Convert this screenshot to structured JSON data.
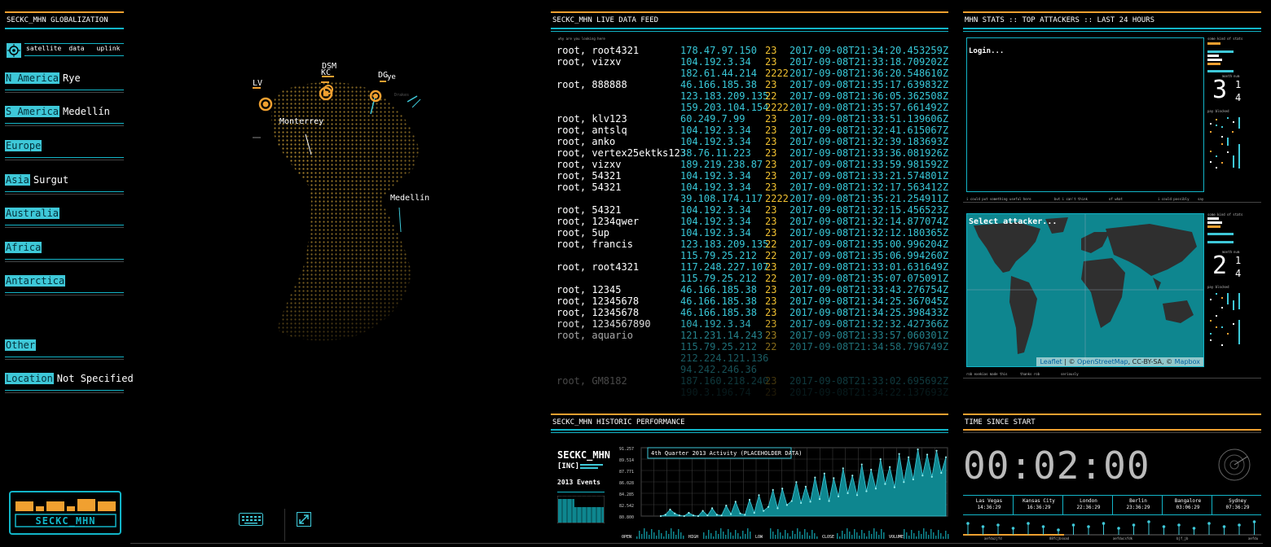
{
  "left": {
    "title": "SECKC_MHN GLOBALIZATION",
    "menu": [
      "satellite",
      "data",
      "uplink"
    ],
    "regions": [
      {
        "label": "N America",
        "value": "Rye"
      },
      {
        "label": "S America",
        "value": "Medellín"
      },
      {
        "label": "Europe",
        "value": ""
      },
      {
        "label": "Asia",
        "value": "Surgut"
      },
      {
        "label": "Australia",
        "value": ""
      },
      {
        "label": "Africa",
        "value": ""
      },
      {
        "label": "Antarctica",
        "value": ""
      },
      {
        "label": "Other",
        "value": ""
      },
      {
        "label": "Location",
        "value": "Not Specified"
      }
    ],
    "logo": "SECKC_MHN"
  },
  "globe": {
    "labels": {
      "lv": "LV",
      "dsm": "DSM",
      "kc": "KC",
      "dg": "DG",
      "rye": "ye",
      "monterrey": "Monterrey",
      "medellin": "Medellín",
      "faint": "Drakes"
    }
  },
  "feed": {
    "title": "SECKC_MHN LIVE DATA FEED",
    "subtitle": "why are you looking here",
    "rows": [
      {
        "user": "root, root4321",
        "ip": "178.47.97.150",
        "port": "23",
        "time": "2017-09-08T21:34:20.453259Z"
      },
      {
        "user": "root, vizxv",
        "ip": "104.192.3.34",
        "port": "23",
        "time": "2017-09-08T21:33:18.709202Z"
      },
      {
        "user": "",
        "ip": "182.61.44.214",
        "port": "2222",
        "time": "2017-09-08T21:36:20.548610Z"
      },
      {
        "user": "root, 888888",
        "ip": "46.166.185.38",
        "port": "23",
        "time": "2017-09-08T21:35:17.639832Z"
      },
      {
        "user": "",
        "ip": "123.183.209.135",
        "port": "22",
        "time": "2017-09-08T21:36:05.362508Z"
      },
      {
        "user": "",
        "ip": "159.203.104.154",
        "port": "2222",
        "time": "2017-09-08T21:35:57.661492Z"
      },
      {
        "user": "root, klv123",
        "ip": "60.249.7.99",
        "port": "23",
        "time": "2017-09-08T21:33:51.139606Z"
      },
      {
        "user": "root, antslq",
        "ip": "104.192.3.34",
        "port": "23",
        "time": "2017-09-08T21:32:41.615067Z"
      },
      {
        "user": "root, anko",
        "ip": "104.192.3.34",
        "port": "23",
        "time": "2017-09-08T21:32:39.183693Z"
      },
      {
        "user": "root, vertex25ektks123",
        "ip": "38.76.11.223",
        "port": "23",
        "time": "2017-09-08T21:33:36.081926Z"
      },
      {
        "user": "root, vizxv",
        "ip": "189.219.238.87",
        "port": "23",
        "time": "2017-09-08T21:33:59.981592Z"
      },
      {
        "user": "root, 54321",
        "ip": "104.192.3.34",
        "port": "23",
        "time": "2017-09-08T21:33:21.574801Z"
      },
      {
        "user": "root, 54321",
        "ip": "104.192.3.34",
        "port": "23",
        "time": "2017-09-08T21:32:17.563412Z"
      },
      {
        "user": "",
        "ip": "39.108.174.117",
        "port": "2222",
        "time": "2017-09-08T21:35:21.254911Z"
      },
      {
        "user": "root, 54321",
        "ip": "104.192.3.34",
        "port": "23",
        "time": "2017-09-08T21:32:15.456523Z"
      },
      {
        "user": "root, 1234qwer",
        "ip": "104.192.3.34",
        "port": "23",
        "time": "2017-09-08T21:32:14.877074Z"
      },
      {
        "user": "root, 5up",
        "ip": "104.192.3.34",
        "port": "23",
        "time": "2017-09-08T21:32:12.180365Z"
      },
      {
        "user": "root, francis",
        "ip": "123.183.209.135",
        "port": "22",
        "time": "2017-09-08T21:35:00.996204Z"
      },
      {
        "user": "",
        "ip": "115.79.25.212",
        "port": "22",
        "time": "2017-09-08T21:35:06.994260Z"
      },
      {
        "user": "root, root4321",
        "ip": "117.248.227.107",
        "port": "23",
        "time": "2017-09-08T21:33:01.631649Z"
      },
      {
        "user": "",
        "ip": "115.79.25.212",
        "port": "22",
        "time": "2017-09-08T21:35:07.075091Z"
      },
      {
        "user": "root, 12345",
        "ip": "46.166.185.38",
        "port": "23",
        "time": "2017-09-08T21:33:43.276754Z"
      },
      {
        "user": "root, 12345678",
        "ip": "46.166.185.38",
        "port": "23",
        "time": "2017-09-08T21:34:25.367045Z"
      },
      {
        "user": "root, 12345678",
        "ip": "46.166.185.38",
        "port": "23",
        "time": "2017-09-08T21:34:25.398433Z"
      },
      {
        "user": "root, 1234567890",
        "ip": "104.192.3.34",
        "port": "23",
        "time": "2017-09-08T21:32:32.427366Z"
      },
      {
        "user": "root, aquario",
        "ip": "121.231.14.243",
        "port": "23",
        "time": "2017-09-08T21:33:57.060301Z"
      },
      {
        "user": "",
        "ip": "115.79.25.212",
        "port": "22",
        "time": "2017-09-08T21:34:58.796749Z"
      },
      {
        "user": "",
        "ip": "212.224.121.136",
        "port": "",
        "time": ""
      },
      {
        "user": "",
        "ip": "94.242.246.36",
        "port": "",
        "time": ""
      },
      {
        "user": "root, GM8182",
        "ip": "187.160.218.240",
        "port": "23",
        "time": "2017-09-08T21:33:02.695692Z"
      },
      {
        "user": "",
        "ip": "190.3.196.74",
        "port": "23",
        "time": "2017-09-08T21:34:22.137693Z"
      }
    ]
  },
  "stats": {
    "title": "MHN STATS :: TOP ATTACKERS :: LAST 24 HOURS",
    "login_text": "Login...",
    "select_text": "Select attacker...",
    "caption1": [
      "i could put something useful here",
      "but i can't think",
      "of what",
      "i could possibly",
      "say"
    ],
    "caption2": [
      "rob exekias made this",
      "thanks rob",
      "seriously"
    ],
    "side_heading": "some kind of stats",
    "month_label": "month",
    "num_label": "num",
    "side1": {
      "big": "3",
      "small_top": "1",
      "small_bot": "4",
      "sub": "pay blocked"
    },
    "side2": {
      "big": "2",
      "small_top": "1",
      "small_bot": "4",
      "sub": "pay blocked"
    },
    "attribution": {
      "leaflet": "Leaflet",
      "sep": " | © ",
      "osm": "OpenStreetMap",
      "mid": ", CC-BY-SA, © ",
      "mapbox": "Mapbox"
    }
  },
  "historic": {
    "title": "SECKC_MHN HISTORIC PERFORMANCE",
    "brand": "SECKC_MHN",
    "inc": "[INC]",
    "events_label": "2013 Events",
    "chart_title": "4th Quarter 2013 Activity (PLACEHOLDER DATA)",
    "bottom_labels": [
      "OPEN",
      "HIGH",
      "LOW",
      "CLOSE",
      "VOLUME"
    ]
  },
  "chart_data": {
    "type": "area",
    "title": "4th Quarter 2013 Activity (PLACEHOLDER DATA)",
    "y_ticks": [
      "91.257",
      "89.514",
      "87.771",
      "86.028",
      "84.285",
      "82.542",
      "80.800"
    ],
    "ylim": [
      80.8,
      91.257
    ],
    "grid": true,
    "values": [
      80.8,
      81.0,
      81.8,
      81.2,
      80.9,
      80.8,
      81.3,
      80.9,
      80.8,
      81.6,
      80.9,
      82.0,
      81.0,
      80.9,
      82.4,
      81.1,
      83.0,
      81.2,
      81.0,
      83.3,
      81.3,
      84.0,
      81.6,
      82.2,
      84.8,
      82.0,
      85.0,
      82.5,
      83.1,
      86.0,
      82.8,
      85.3,
      83.0,
      86.7,
      83.4,
      87.3,
      83.1,
      86.6,
      83.8,
      88.1,
      84.3,
      87.0,
      84.0,
      88.7,
      84.6,
      87.9,
      85.0,
      89.5,
      85.7,
      88.3,
      85.2,
      90.3,
      86.0,
      89.8,
      86.4,
      91.0,
      87.0,
      90.2,
      86.8,
      90.8,
      87.4,
      89.8
    ]
  },
  "timer": {
    "title": "TIME SINCE START",
    "elapsed": "00:02:00",
    "clocks": [
      {
        "city": "Las Vegas",
        "time": "14:36:29"
      },
      {
        "city": "Kansas City",
        "time": "16:36:29"
      },
      {
        "city": "London",
        "time": "22:36:29"
      },
      {
        "city": "Berlin",
        "time": "23:36:29"
      },
      {
        "city": "Bangalore",
        "time": "03:06:29"
      },
      {
        "city": "Sydney",
        "time": "07:36:29"
      }
    ],
    "footer": [
      "aefduzjfd",
      "88fcjbsoad",
      "aefducsfdk",
      "bjf_jb",
      "aefdu"
    ]
  },
  "colors": {
    "cyan": "#12b5c8",
    "orange": "#f0a030",
    "yellow": "#f0c030"
  }
}
